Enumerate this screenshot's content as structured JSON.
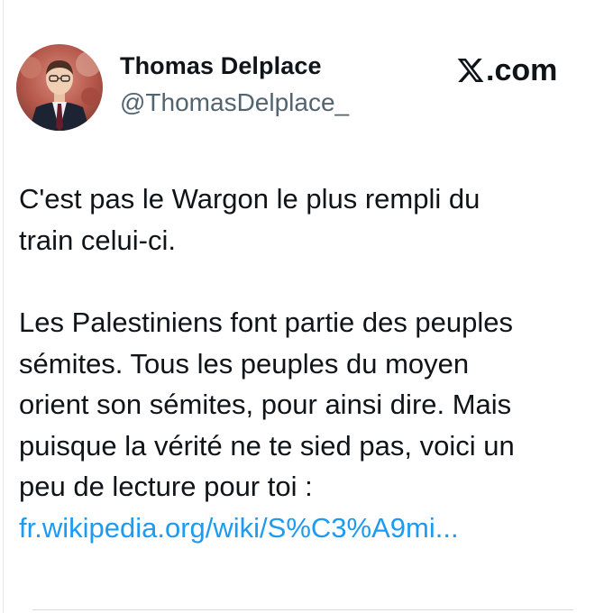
{
  "author": {
    "display_name": "Thomas Delplace",
    "handle": "@ThomasDelplace_",
    "avatar_icon": "profile-photo"
  },
  "brand": {
    "icon": "x-logo-icon",
    "label": ".com"
  },
  "tweet": {
    "lines": [
      "C'est pas le Wargon le plus rempli du",
      "train celui-ci.",
      "",
      "Les Palestiniens font partie des peuples",
      "sémites. Tous les peuples du moyen",
      "orient son sémites, pour ainsi dire. Mais",
      "puisque la vérité ne te sied pas, voici un",
      "peu de lecture pour toi :"
    ],
    "link": "fr.wikipedia.org/wiki/S%C3%A9mi..."
  },
  "colors": {
    "text": "#0f1419",
    "secondary": "#536471",
    "link": "#1d9bf0",
    "background": "#ffffff"
  }
}
